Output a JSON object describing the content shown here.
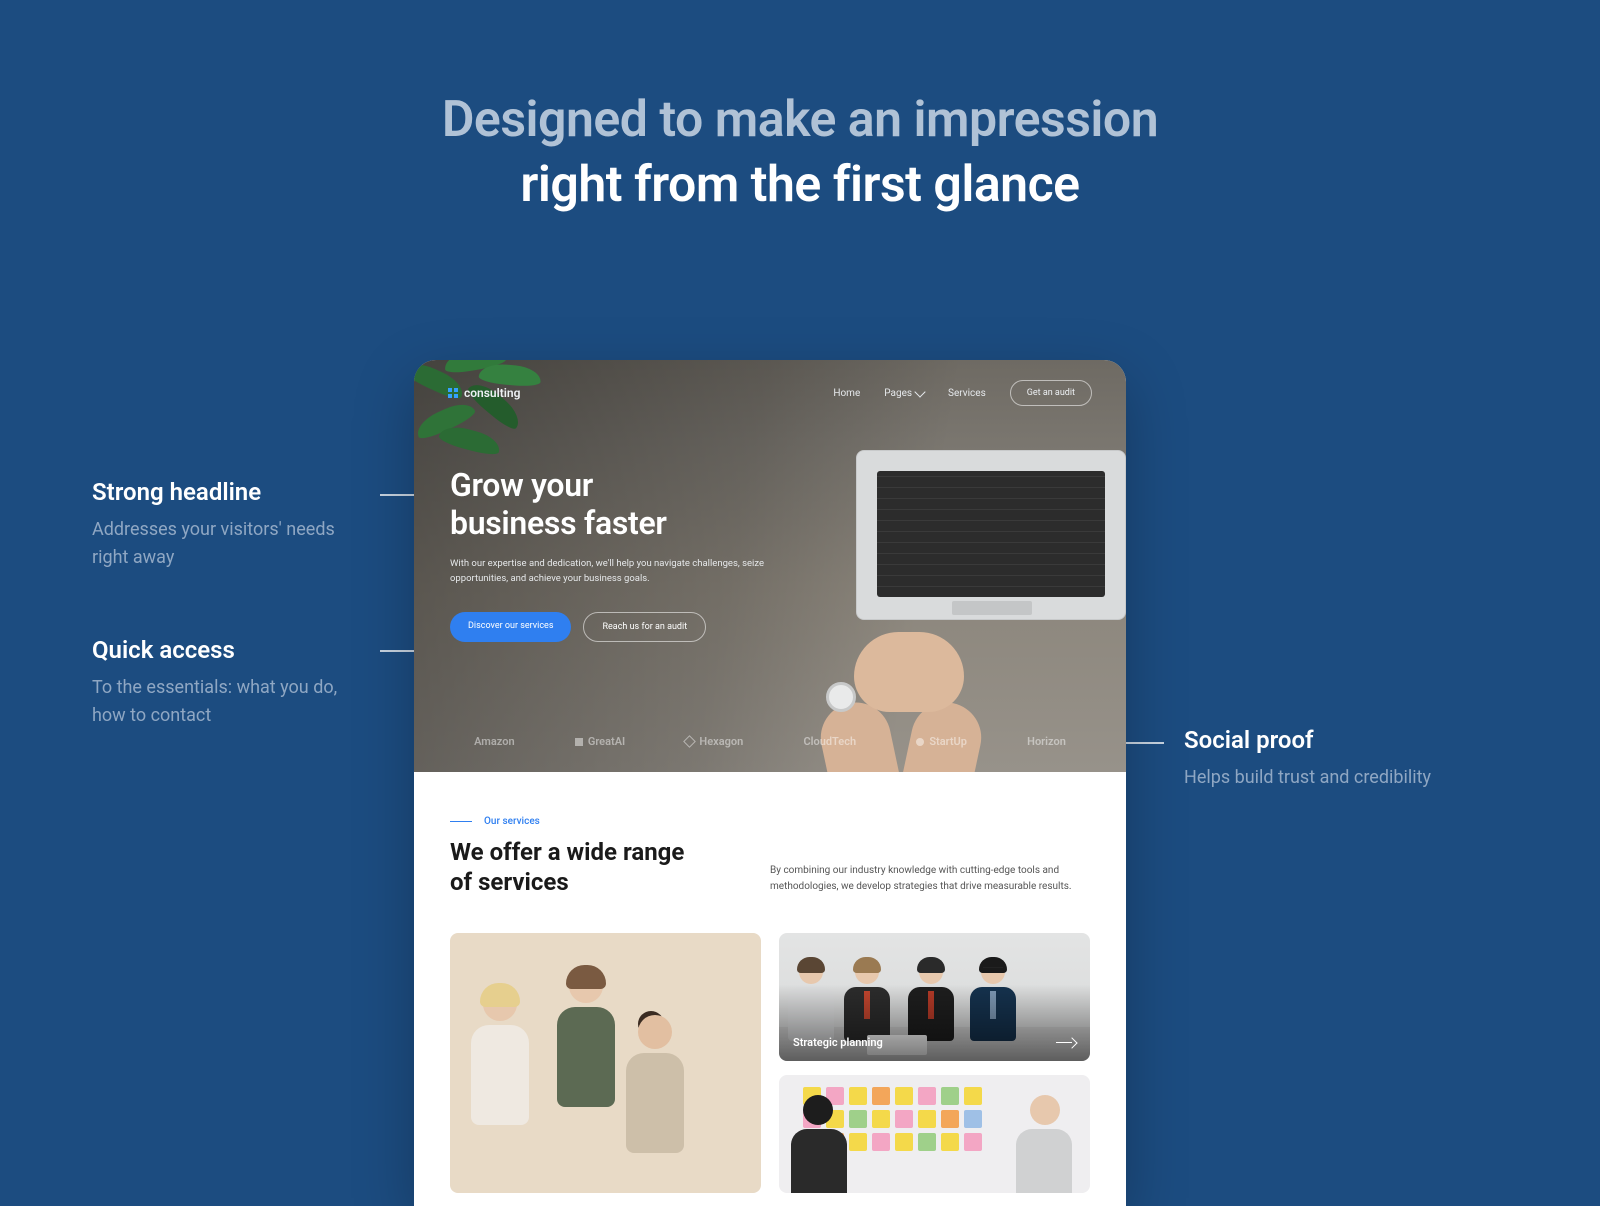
{
  "outer": {
    "heading_line1": "Designed to make an impression",
    "heading_line2": "right from the first glance"
  },
  "callouts": {
    "headline": {
      "title": "Strong headline",
      "desc": "Addresses your visitors' needs right away"
    },
    "quick": {
      "title": "Quick access",
      "desc": "To the essentials: what you do, how to contact"
    },
    "proof": {
      "title": "Social proof",
      "desc": "Helps build trust and credibility"
    }
  },
  "mockup": {
    "brand": "consulting",
    "nav": {
      "home": "Home",
      "pages": "Pages",
      "services": "Services",
      "cta": "Get an audit"
    },
    "hero": {
      "title_line1": "Grow your",
      "title_line2": "business faster",
      "sub": "With our expertise and dedication, we'll help you navigate challenges, seize opportunities, and achieve your business goals.",
      "primary_cta": "Discover our services",
      "secondary_cta": "Reach us for an audit"
    },
    "logos": [
      "Amazon",
      "GreatAI",
      "Hexagon",
      "CloudTech",
      "StartUp",
      "Horizon"
    ],
    "services": {
      "eyebrow": "Our services",
      "title": "We offer a wide range of services",
      "desc": "By combining our industry knowledge with cutting-edge tools and methodologies, we develop strategies that drive measurable results.",
      "card1_title": "Strategic planning"
    }
  }
}
